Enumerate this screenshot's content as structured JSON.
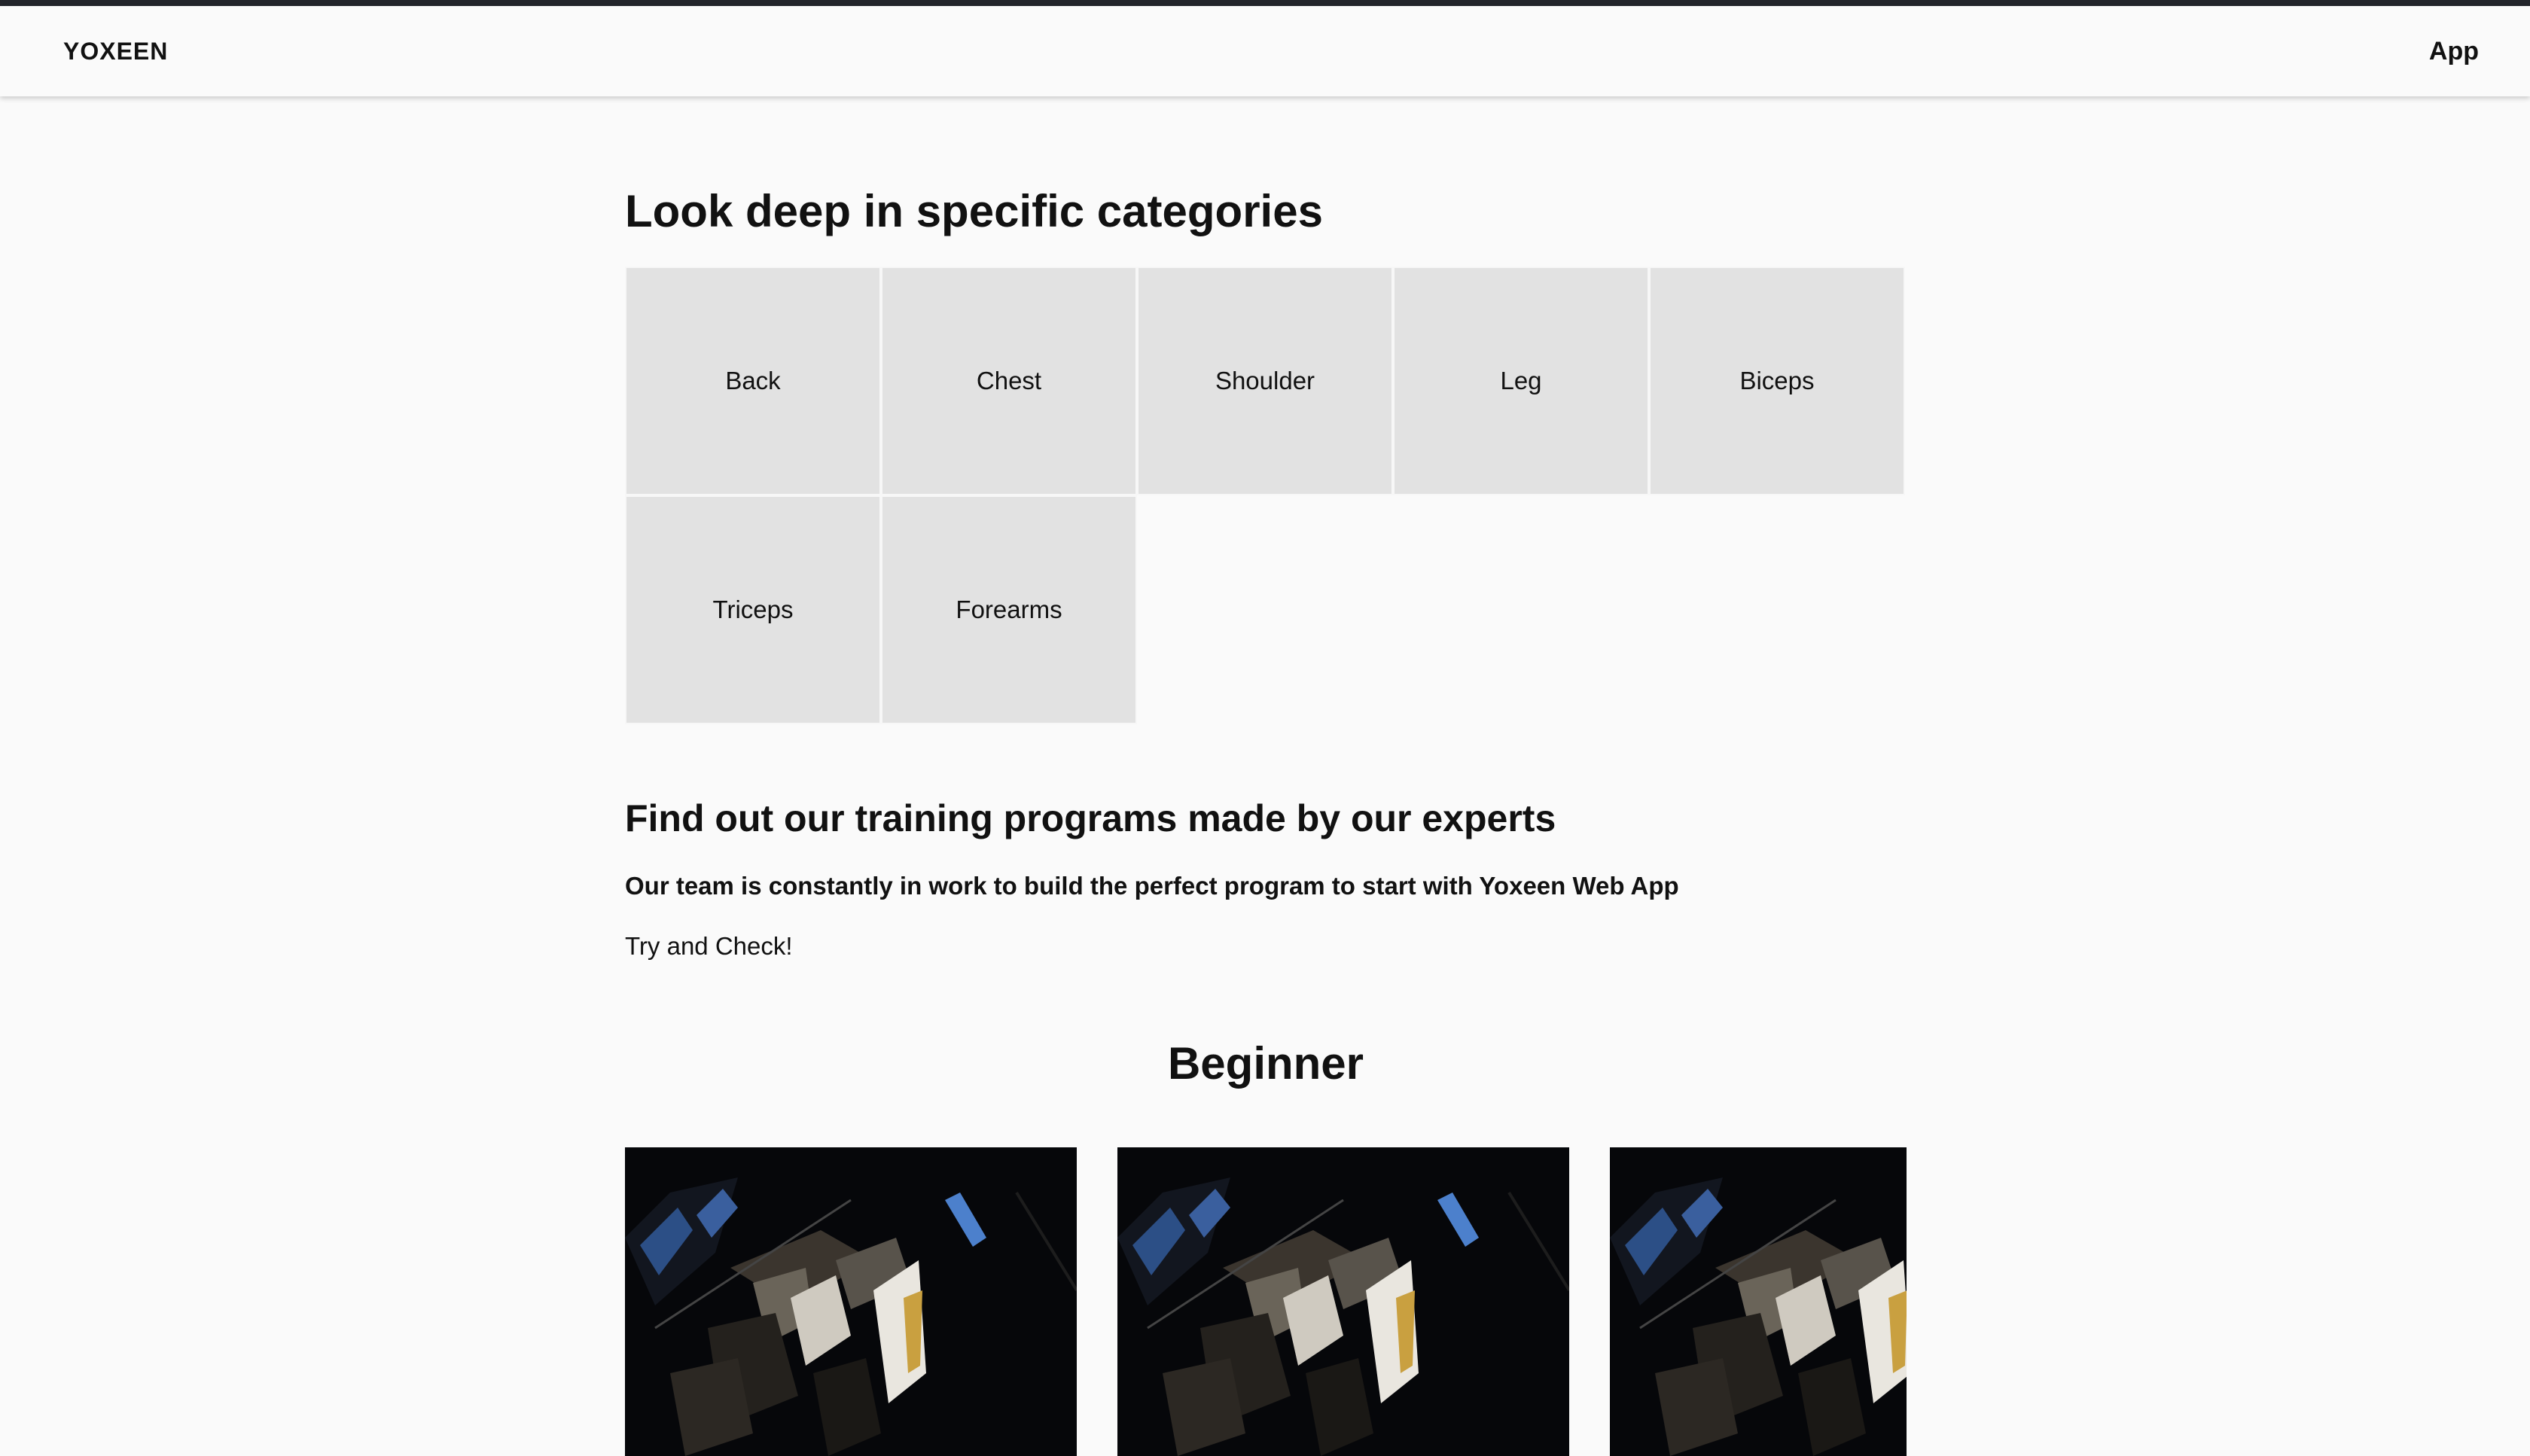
{
  "navbar": {
    "brand": "YOXEEN",
    "app_link": "App"
  },
  "categories": {
    "title": "Look deep in specific categories",
    "items": [
      "Back",
      "Chest",
      "Shoulder",
      "Leg",
      "Biceps",
      "Triceps",
      "Forearms"
    ]
  },
  "programs": {
    "title": "Find out our training programs made by our experts",
    "subtitle": "Our team is constantly in work to build the perfect program to start with Yoxeen Web App",
    "cta_text": "Try and Check!"
  },
  "level": {
    "title": "Beginner",
    "cards": [
      {
        "image": "dark-architecture-photo"
      },
      {
        "image": "dark-architecture-photo"
      },
      {
        "image": "dark-architecture-photo"
      }
    ]
  },
  "colors": {
    "background": "#fafafa",
    "top_border": "#23252b",
    "tile": "#e2e2e2",
    "text": "#111111"
  }
}
